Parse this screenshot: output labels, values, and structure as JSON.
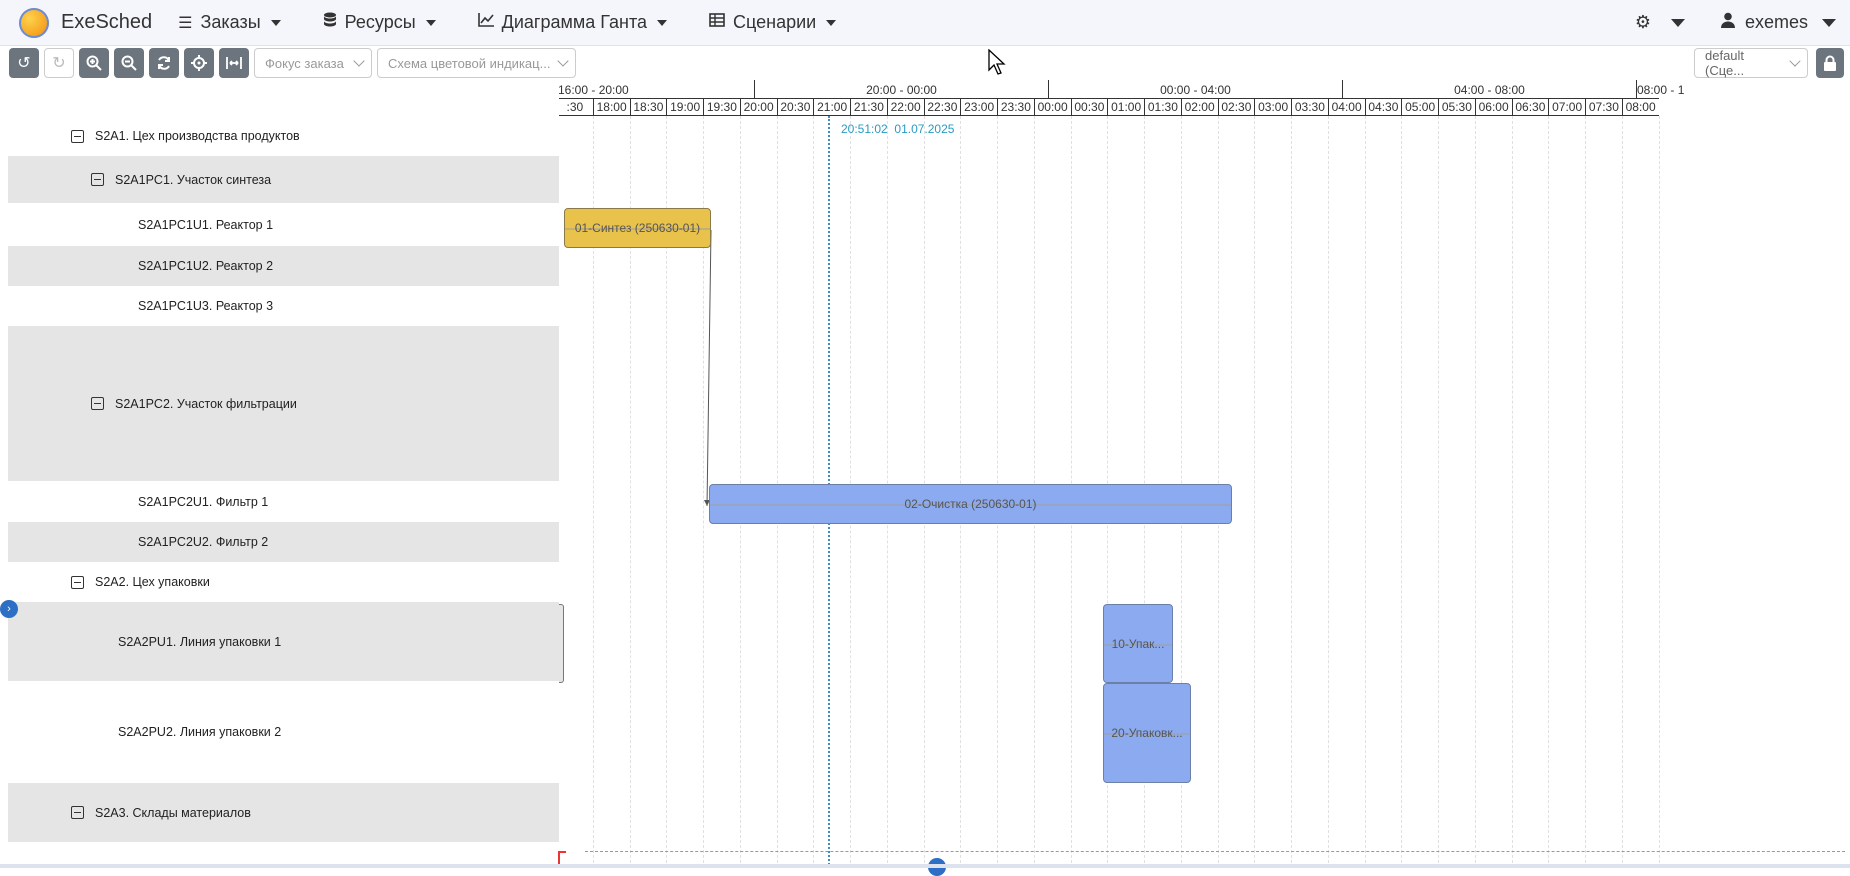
{
  "app": {
    "title": "ExeSched"
  },
  "nav": {
    "orders": "Заказы",
    "resources": "Ресурсы",
    "gantt": "Диаграмма Ганта",
    "scenarios": "Сценарии",
    "user": "exemes"
  },
  "toolbar": {
    "order_focus_placeholder": "Фокус заказа",
    "color_scheme_placeholder": "Схема цветовой индикац...",
    "scenario_select": "default (Сце..."
  },
  "resources": [
    {
      "label": "S2A1. Цех производства продуктов"
    },
    {
      "label": "S2A1PC1. Участок синтеза"
    },
    {
      "label": "S2A1PC1U1. Реактор 1"
    },
    {
      "label": "S2A1PC1U2. Реактор 2"
    },
    {
      "label": "S2A1PC1U3. Реактор 3"
    },
    {
      "label": "S2A1PC2. Участок фильтрации"
    },
    {
      "label": "S2A1PC2U1. Фильтр 1"
    },
    {
      "label": "S2A1PC2U2. Фильтр 2"
    },
    {
      "label": "S2A2. Цех упаковки"
    },
    {
      "label": "S2A2PU1. Линия упаковки 1"
    },
    {
      "label": "S2A2PU2. Линия упаковки 2"
    },
    {
      "label": "S2A3. Склады материалов"
    }
  ],
  "timescale": {
    "major": [
      "16:00 - 20:00",
      "20:00 - 00:00",
      "00:00 - 04:00",
      "04:00 - 08:00",
      "08:00 - 1"
    ],
    "minor": [
      ":30",
      "18:00",
      "18:30",
      "19:00",
      "19:30",
      "20:00",
      "20:30",
      "21:00",
      "21:30",
      "22:00",
      "22:30",
      "23:00",
      "23:30",
      "00:00",
      "00:30",
      "01:00",
      "01:30",
      "02:00",
      "02:30",
      "03:00",
      "03:30",
      "04:00",
      "04:30",
      "05:00",
      "05:30",
      "06:00",
      "06:30",
      "07:00",
      "07:30",
      "08:00"
    ]
  },
  "now_marker": {
    "time": "20:51:02",
    "date": "01.07.2025"
  },
  "tasks": [
    {
      "label": "01-Синтез (250630-01)",
      "color": "#e8c24a"
    },
    {
      "label": "02-Очистка (250630-01)",
      "color": "#8caaf0"
    },
    {
      "label": "10-Упак...",
      "color": "#8caaf0"
    },
    {
      "label": "20-Упаковк...",
      "color": "#8caaf0"
    }
  ]
}
